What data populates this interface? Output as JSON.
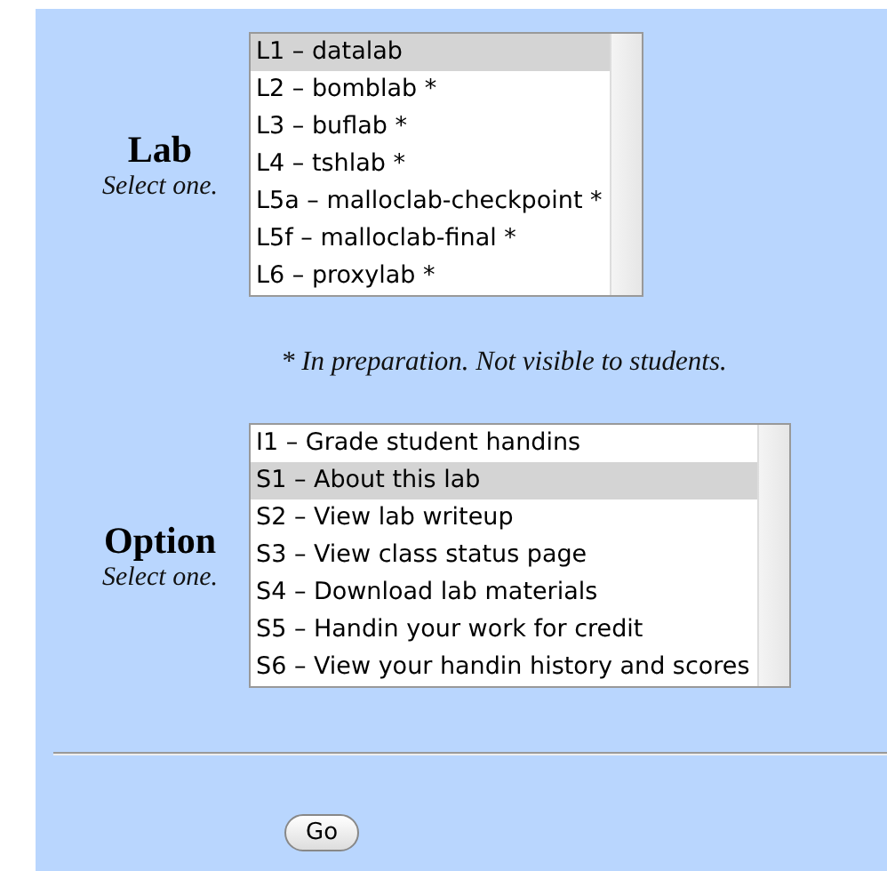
{
  "lab": {
    "label": "Lab",
    "hint": "Select one.",
    "options": [
      {
        "text": "L1 – datalab",
        "selected": true
      },
      {
        "text": "L2 – bomblab *",
        "selected": false
      },
      {
        "text": "L3 – buflab *",
        "selected": false
      },
      {
        "text": "L4 – tshlab *",
        "selected": false
      },
      {
        "text": "L5a – malloclab-checkpoint *",
        "selected": false
      },
      {
        "text": "L5f – malloclab-final *",
        "selected": false
      },
      {
        "text": "L6 – proxylab *",
        "selected": false
      }
    ]
  },
  "footnote": "* In preparation. Not visible to students.",
  "option": {
    "label": "Option",
    "hint": "Select one.",
    "options": [
      {
        "text": "I1 – Grade student handins",
        "selected": false
      },
      {
        "text": "S1 – About this lab",
        "selected": true
      },
      {
        "text": "S2 – View lab writeup",
        "selected": false
      },
      {
        "text": "S3 – View class status page",
        "selected": false
      },
      {
        "text": "S4 – Download lab materials",
        "selected": false
      },
      {
        "text": "S5 – Handin your work for credit",
        "selected": false
      },
      {
        "text": "S6 – View your handin history and scores",
        "selected": false
      }
    ]
  },
  "button": "Go"
}
